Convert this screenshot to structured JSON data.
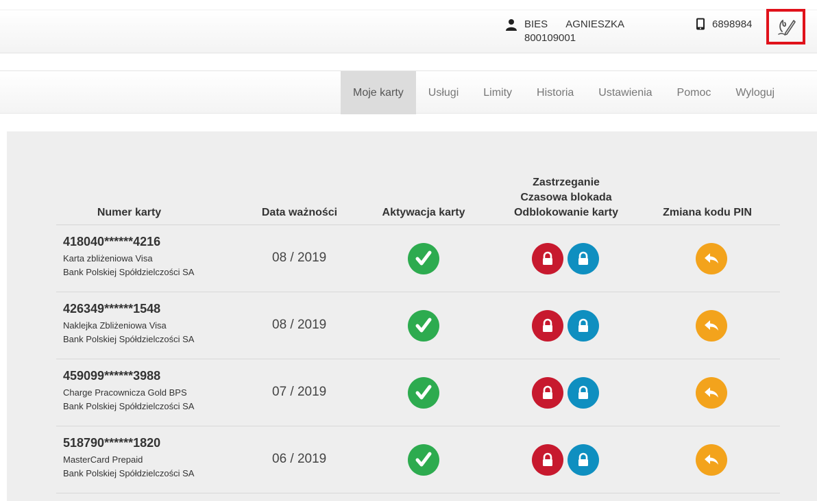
{
  "header": {
    "user": {
      "surname": "BIES",
      "first_name": "AGNIESZKA",
      "client_id": "800109001",
      "icon": "person-icon"
    },
    "phone": {
      "number": "6898984",
      "icon": "phone-icon"
    },
    "sign_button_icon": "signature-pen-icon"
  },
  "nav": {
    "items": [
      {
        "label": "Moje karty",
        "active": true
      },
      {
        "label": "Usługi"
      },
      {
        "label": "Limity"
      },
      {
        "label": "Historia"
      },
      {
        "label": "Ustawienia"
      },
      {
        "label": "Pomoc"
      },
      {
        "label": "Wyloguj"
      }
    ]
  },
  "table": {
    "headers": {
      "card_number": "Numer karty",
      "expiry": "Data ważności",
      "activation": "Aktywacja karty",
      "block_line1": "Zastrzeganie",
      "block_line2": "Czasowa blokada",
      "block_line3": "Odblokowanie karty",
      "pin": "Zmiana kodu PIN"
    },
    "rows": [
      {
        "number": "418040******4216",
        "name": "Karta zbliżeniowa Visa",
        "bank": "Bank Polskiej Spółdzielczości SA",
        "expiry": "08 / 2019"
      },
      {
        "number": "426349******1548",
        "name": "Naklejka Zbliżeniowa Visa",
        "bank": "Bank Polskiej Spółdzielczości SA",
        "expiry": "08 / 2019"
      },
      {
        "number": "459099******3988",
        "name": "Charge Pracownicza Gold BPS",
        "bank": "Bank Polskiej Spółdzielczości SA",
        "expiry": "07 / 2019"
      },
      {
        "number": "518790******1820",
        "name": "MasterCard Prepaid",
        "bank": "Bank Polskiej Spółdzielczości SA",
        "expiry": "06 / 2019"
      }
    ],
    "icons": {
      "activation": "checkmark-icon",
      "block": "lock-icon",
      "unblock": "unlock-icon",
      "pin": "reply-arrow-icon"
    }
  },
  "colors": {
    "activation": "#2dab4f",
    "block": "#c7192e",
    "unblock": "#0f8fc0",
    "pin": "#f3a31c",
    "highlight": "#e0121b"
  }
}
